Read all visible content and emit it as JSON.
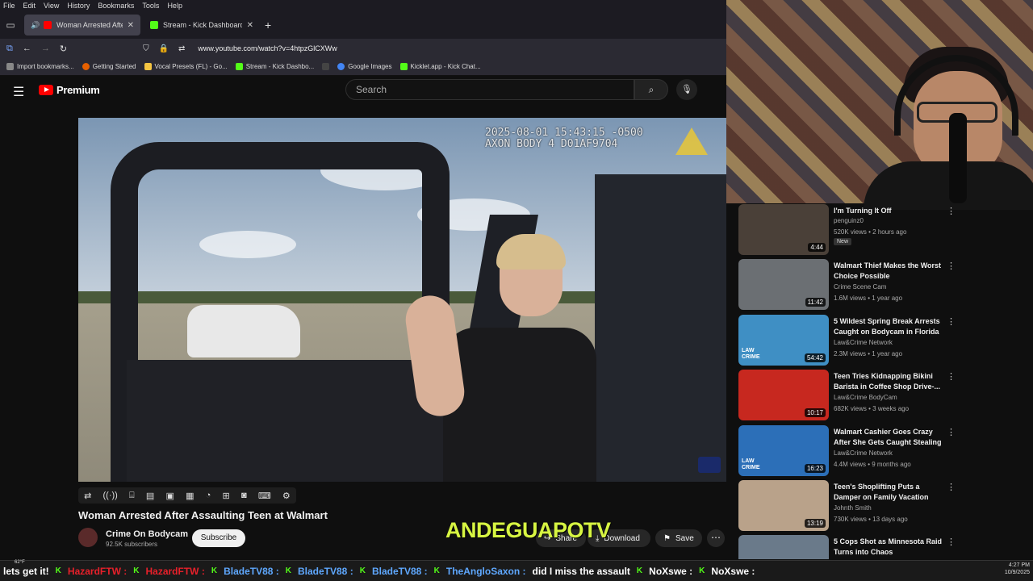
{
  "browser": {
    "menu": [
      "File",
      "Edit",
      "View",
      "History",
      "Bookmarks",
      "Tools",
      "Help"
    ],
    "tabs": [
      {
        "label": "Woman Arrested After Assa",
        "color": "#ff0000"
      },
      {
        "label": "Stream - Kick Dashboard",
        "color": "#53fc18"
      }
    ],
    "url": "www.youtube.com/watch?v=4htpzGlCXWw",
    "bookmarks": [
      {
        "label": "Import bookmarks...",
        "color": "#888888"
      },
      {
        "label": "Getting Started",
        "color": "#e66000"
      },
      {
        "label": "Vocal Presets (FL) - Go...",
        "color": "#f5c542"
      },
      {
        "label": "Stream - Kick Dashbo...",
        "color": "#53fc18"
      },
      {
        "label": "Google Images",
        "color": "#4285f4"
      },
      {
        "label": "Kicklet.app - Kick Chat...",
        "color": "#53fc18"
      }
    ]
  },
  "youtube": {
    "brand": "Premium",
    "search_placeholder": "Search",
    "video": {
      "timestamp_line1": "2025-08-01 15:43:15 -0500",
      "timestamp_line2": "AXON BODY 4 D01AF9704",
      "title": "Woman Arrested After Assaulting Teen at Walmart",
      "channel": "Crime On Bodycam",
      "subscribers": "92.5K subscribers",
      "subscribe_label": "Subscribe",
      "share_label": "Share",
      "download_label": "Download",
      "save_label": "Save"
    },
    "recommendations": [
      {
        "title": "I'm Turning It Off",
        "channel": "penguinz0",
        "meta": "520K views • 2 hours ago",
        "duration": "4:44",
        "badge": "New",
        "thumb": "#4a4038"
      },
      {
        "title": "Walmart Thief Makes the Worst Choice Possible",
        "channel": "Crime Scene Cam",
        "meta": "1.6M views • 1 year ago",
        "duration": "11:42",
        "badge": "",
        "thumb": "#6b6f73"
      },
      {
        "title": "5 Wildest Spring Break Arrests Caught on Bodycam in Florida",
        "channel": "Law&Crime Network",
        "meta": "2.3M views • 1 year ago",
        "duration": "54:42",
        "badge": "",
        "thumb": "#3f8fc4"
      },
      {
        "title": "Teen Tries Kidnapping Bikini Barista in Coffee Shop Drive-...",
        "channel": "Law&Crime BodyCam",
        "meta": "682K views • 3 weeks ago",
        "duration": "10:17",
        "badge": "",
        "thumb": "#c7281f"
      },
      {
        "title": "Walmart Cashier Goes Crazy After She Gets Caught Stealing",
        "channel": "Law&Crime Network",
        "meta": "4.4M views • 9 months ago",
        "duration": "16:23",
        "badge": "",
        "thumb": "#2c6fb8"
      },
      {
        "title": "Teen's Shoplifting Puts a Damper on Family Vacation",
        "channel": "Johnth Smith",
        "meta": "730K views • 13 days ago",
        "duration": "13:19",
        "badge": "",
        "thumb": "#b9a28a"
      },
      {
        "title": "5 Cops Shot as Minnesota Raid Turns into Chaos",
        "channel": "",
        "meta": "",
        "duration": "",
        "badge": "",
        "thumb": "#6a7a8a"
      }
    ],
    "lc_label_1": "LAW",
    "lc_label_2": "CRIME"
  },
  "overlay": {
    "streamer_name": "ANDEGUAPOTV"
  },
  "ticker": {
    "items": [
      {
        "text": "lets get it!",
        "cls": "tk-white"
      },
      {
        "text": "HazardFTW :",
        "cls": "tk-red"
      },
      {
        "text": "HazardFTW :",
        "cls": "tk-red"
      },
      {
        "text": "BladeTV88 :",
        "cls": "tk-blue"
      },
      {
        "text": "BladeTV88 :",
        "cls": "tk-blue"
      },
      {
        "text": "BladeTV88 :",
        "cls": "tk-blue"
      },
      {
        "text": "TheAngloSaxon :",
        "cls": "tk-blue"
      },
      {
        "text": "did I miss the assault",
        "cls": "tk-white"
      },
      {
        "text": "NoXswe :",
        "cls": "tk-white"
      },
      {
        "text": "NoXswe :",
        "cls": "tk-white"
      }
    ],
    "weather": "62°F",
    "time": "4:27 PM",
    "date": "10/9/2025"
  }
}
